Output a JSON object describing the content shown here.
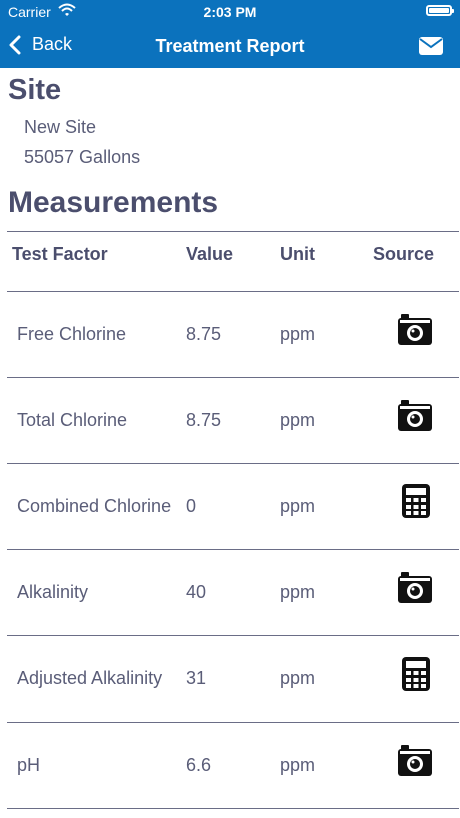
{
  "status_bar": {
    "carrier": "Carrier",
    "time": "2:03 PM"
  },
  "nav": {
    "back_label": "Back",
    "title": "Treatment Report"
  },
  "site": {
    "heading": "Site",
    "name": "New Site",
    "volume": "55057 Gallons"
  },
  "measurements": {
    "heading": "Measurements",
    "columns": [
      "Test Factor",
      "Value",
      "Unit",
      "Source"
    ],
    "rows": [
      {
        "factor": "Free Chlorine",
        "value": "8.75",
        "unit": "ppm",
        "source_icon": "camera-icon"
      },
      {
        "factor": "Total Chlorine",
        "value": "8.75",
        "unit": "ppm",
        "source_icon": "camera-icon"
      },
      {
        "factor": "Combined Chlorine",
        "value": "0",
        "unit": "ppm",
        "source_icon": "calculator-icon"
      },
      {
        "factor": "Alkalinity",
        "value": "40",
        "unit": "ppm",
        "source_icon": "camera-icon"
      },
      {
        "factor": "Adjusted Alkalinity",
        "value": "31",
        "unit": "ppm",
        "source_icon": "calculator-icon"
      },
      {
        "factor": "pH",
        "value": "6.6",
        "unit": "ppm",
        "source_icon": "camera-icon"
      }
    ]
  },
  "colors": {
    "nav_bar": "#0b72bd",
    "heading_text": "#4b4e6d",
    "body_text": "#5a5d78"
  }
}
